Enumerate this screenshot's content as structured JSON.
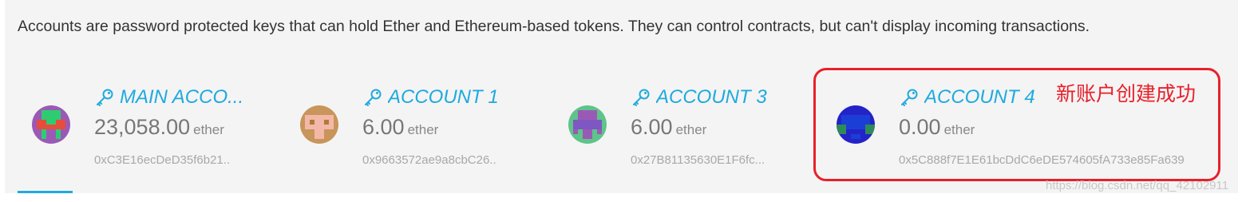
{
  "description": "Accounts are password protected keys that can hold Ether and Ethereum-based tokens. They can control contracts, but can't display incoming transactions.",
  "accounts": [
    {
      "name": "MAIN ACCO...",
      "balance": "23,058.00",
      "unit": "ether",
      "address": "0xC3E16ecDeD35f6b21..",
      "avatar_colors": [
        "#9b59b6",
        "#e74c3c",
        "#2ecc71"
      ]
    },
    {
      "name": "ACCOUNT 1",
      "balance": "6.00",
      "unit": "ether",
      "address": "0x9663572ae9a8cbC26..",
      "avatar_colors": [
        "#c8955a",
        "#f3b8a8",
        "#b07a3a"
      ]
    },
    {
      "name": "ACCOUNT 3",
      "balance": "6.00",
      "unit": "ether",
      "address": "0x27B81135630E1F6fc...",
      "avatar_colors": [
        "#9b59b6",
        "#5ec48a",
        "#7e57c2"
      ]
    },
    {
      "name": "ACCOUNT 4",
      "balance": "0.00",
      "unit": "ether",
      "address": "0x5C888f7E1E61bcDdC6eDE574605fA733e85Fa639",
      "avatar_colors": [
        "#2323c8",
        "#1b3fd6",
        "#2e8b57"
      ]
    }
  ],
  "annotation": "新账户创建成功",
  "watermark": "https://blog.csdn.net/qq_42102911",
  "colors": {
    "accent": "#1eaadf",
    "highlight": "#e8202a"
  },
  "icons": {
    "account_key": "key-icon"
  }
}
